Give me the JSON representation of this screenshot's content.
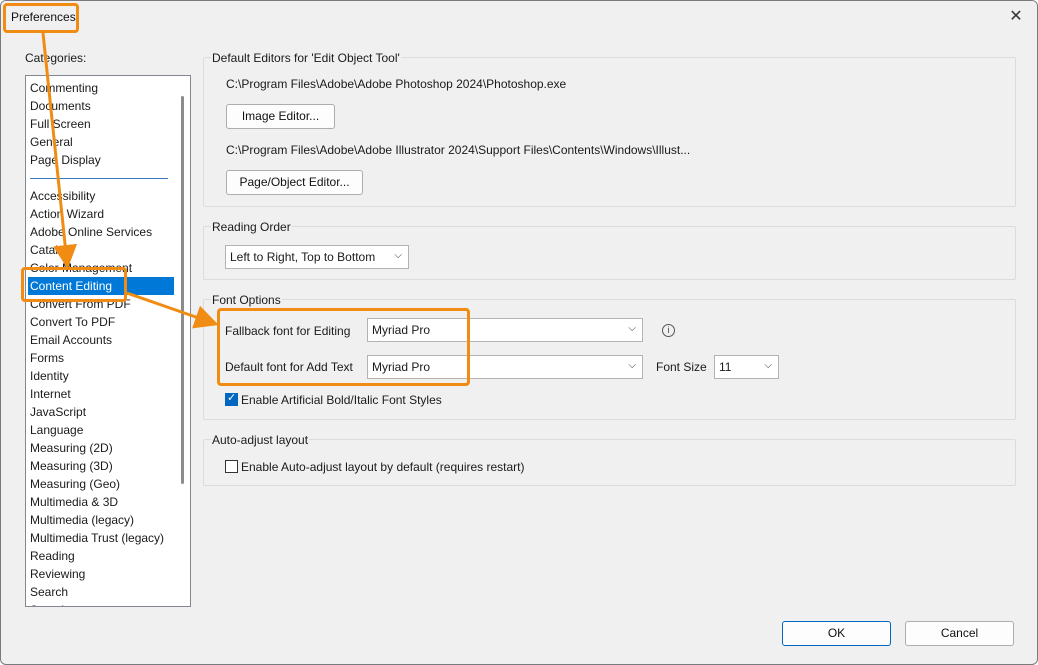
{
  "window": {
    "title": "Preferences",
    "close_glyph": "✕"
  },
  "categories": {
    "label": "Categories:",
    "group_top": [
      "Commenting",
      "Documents",
      "Full Screen",
      "General",
      "Page Display"
    ],
    "group_main": [
      "Accessibility",
      "Action Wizard",
      "Adobe Online Services",
      "Catalog",
      "Color Management",
      "Content Editing",
      "Convert From PDF",
      "Convert To PDF",
      "Email Accounts",
      "Forms",
      "Identity",
      "Internet",
      "JavaScript",
      "Language",
      "Measuring (2D)",
      "Measuring (3D)",
      "Measuring (Geo)",
      "Multimedia & 3D",
      "Multimedia (legacy)",
      "Multimedia Trust (legacy)",
      "Reading",
      "Reviewing",
      "Search",
      "Security"
    ],
    "selected": "Content Editing"
  },
  "default_editors": {
    "label": "Default Editors for 'Edit Object Tool'",
    "image_path": "C:\\Program Files\\Adobe\\Adobe Photoshop 2024\\Photoshop.exe",
    "image_button": "Image Editor...",
    "page_path": "C:\\Program Files\\Adobe\\Adobe Illustrator 2024\\Support Files\\Contents\\Windows\\Illust...",
    "page_button": "Page/Object Editor..."
  },
  "reading_order": {
    "label": "Reading Order",
    "value": "Left to Right, Top to Bottom"
  },
  "font_options": {
    "label": "Font Options",
    "fallback_label": "Fallback font for Editing",
    "fallback_value": "Myriad Pro",
    "default_label": "Default font for Add Text",
    "default_value": "Myriad Pro",
    "font_size_label": "Font Size",
    "font_size_value": "11",
    "bold_italic_label": "Enable Artificial Bold/Italic Font Styles",
    "bold_italic_checked": true
  },
  "auto_adjust": {
    "label": "Auto-adjust layout",
    "checkbox_label": "Enable Auto-adjust layout by default (requires restart)",
    "checked": false
  },
  "footer": {
    "ok": "OK",
    "cancel": "Cancel"
  },
  "colors": {
    "highlight": "#f08c14",
    "selection": "#0078d7",
    "checkbox": "#0067c0"
  },
  "icons": {
    "dropdown": "chevron-down-icon",
    "info": "info-icon",
    "close": "close-icon"
  }
}
